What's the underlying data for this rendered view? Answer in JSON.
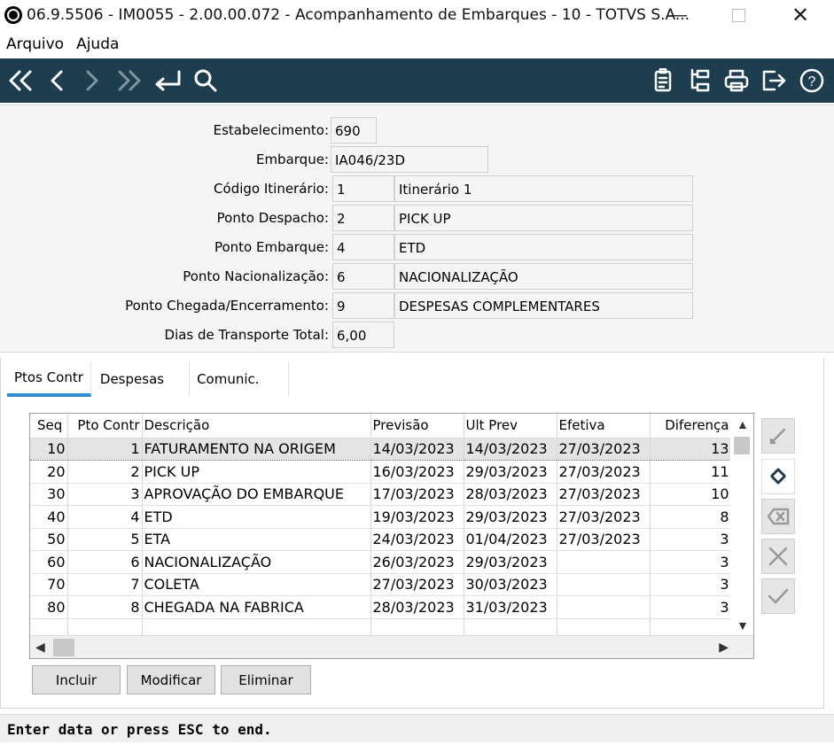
{
  "window": {
    "title": "06.9.5506 - IM0055 - 2.00.00.072 - Acompanhamento de Embarques - 10 - TOTVS S.A...",
    "minimize": "—",
    "close": "✕"
  },
  "menu": {
    "items": [
      "Arquivo",
      "Ajuda"
    ]
  },
  "toolbar": {
    "nav_icons": [
      "first-record-icon",
      "previous-record-icon",
      "next-record-icon",
      "last-record-icon",
      "goto-return-icon",
      "search-icon"
    ],
    "right_icons": [
      "report-icon",
      "tree-icon",
      "print-icon",
      "exit-icon",
      "help-icon"
    ],
    "help_glyph": "?"
  },
  "form": {
    "estabelecimento": {
      "label": "Estabelecimento:",
      "value": "690"
    },
    "embarque": {
      "label": "Embarque:",
      "value": "IA046/23D"
    },
    "codigo_itinerario": {
      "label": "Código Itinerário:",
      "code": "1",
      "desc": "Itinerário 1"
    },
    "ponto_despacho": {
      "label": "Ponto Despacho:",
      "code": "2",
      "desc": "PICK UP"
    },
    "ponto_embarque": {
      "label": "Ponto Embarque:",
      "code": "4",
      "desc": "ETD"
    },
    "ponto_nacionalizacao": {
      "label": "Ponto Nacionalização:",
      "code": "6",
      "desc": "NACIONALIZAÇÃO"
    },
    "ponto_chegada": {
      "label": "Ponto Chegada/Encerramento:",
      "code": "9",
      "desc": "DESPESAS COMPLEMENTARES"
    },
    "dias_transporte": {
      "label": "Dias de Transporte Total:",
      "value": "6,00"
    }
  },
  "tabs": [
    "Ptos Contr",
    "Despesas",
    "Comunic."
  ],
  "grid": {
    "columns": [
      "Seq",
      "Pto Contr",
      "Descrição",
      "Previsão",
      "Ult Prev",
      "Efetiva",
      "Diferença"
    ],
    "rows": [
      [
        "10",
        "1",
        "FATURAMENTO NA ORIGEM",
        "14/03/2023",
        "14/03/2023",
        "27/03/2023",
        "13"
      ],
      [
        "20",
        "2",
        "PICK UP",
        "16/03/2023",
        "29/03/2023",
        "27/03/2023",
        "11"
      ],
      [
        "30",
        "3",
        "APROVAÇÃO DO EMBARQUE",
        "17/03/2023",
        "28/03/2023",
        "27/03/2023",
        "10"
      ],
      [
        "40",
        "4",
        "ETD",
        "19/03/2023",
        "29/03/2023",
        "27/03/2023",
        "8"
      ],
      [
        "50",
        "5",
        "ETA",
        "24/03/2023",
        "01/04/2023",
        "27/03/2023",
        "3"
      ],
      [
        "60",
        "6",
        "NACIONALIZAÇÃO",
        "26/03/2023",
        "29/03/2023",
        "",
        "3"
      ],
      [
        "70",
        "7",
        "COLETA",
        "27/03/2023",
        "30/03/2023",
        "",
        "3"
      ],
      [
        "80",
        "8",
        "CHEGADA NA FABRICA",
        "28/03/2023",
        "31/03/2023",
        "",
        "3"
      ],
      [
        "",
        "",
        "",
        "",
        "",
        "",
        ""
      ]
    ],
    "selected_row": 0
  },
  "side_buttons": [
    "edit-icon",
    "refresh-icon",
    "clear-icon",
    "cancel-icon",
    "confirm-icon"
  ],
  "buttons": {
    "incluir": "Incluir",
    "modificar": "Modificar",
    "eliminar": "Eliminar"
  },
  "status": "Enter data or press ESC to end."
}
